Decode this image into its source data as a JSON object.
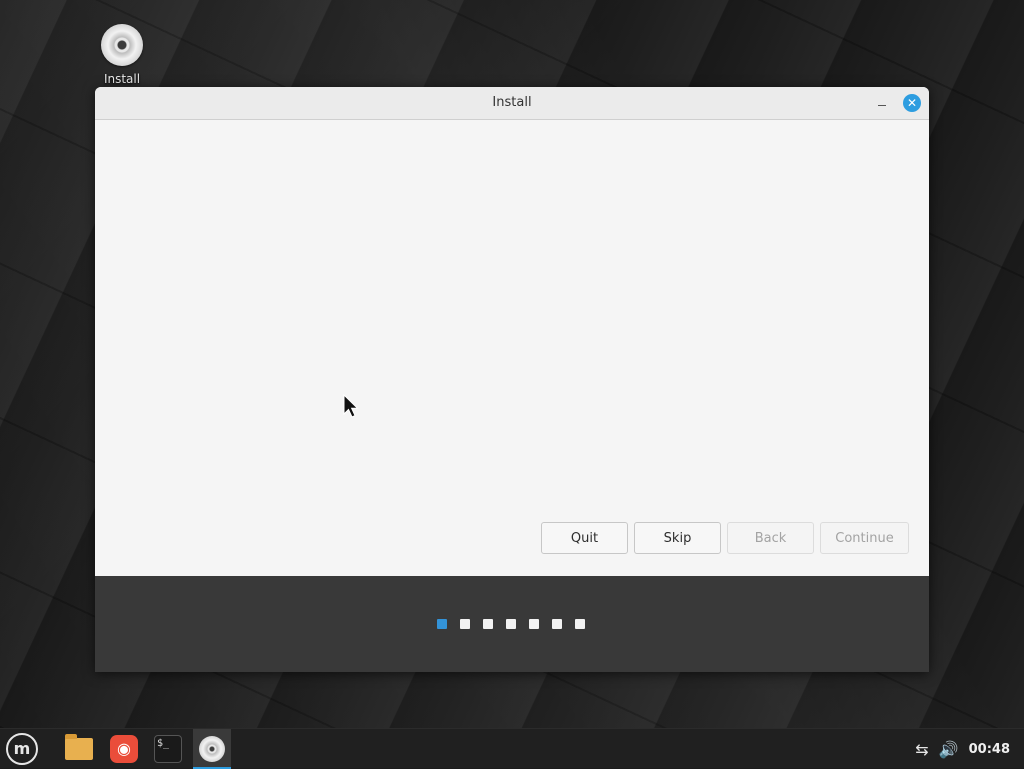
{
  "desktop": {
    "icons": [
      {
        "label": "Install",
        "icon": "disc-icon"
      }
    ]
  },
  "window": {
    "title": "Install",
    "minimize_glyph": "–",
    "close_glyph": "✕",
    "buttons": {
      "quit": "Quit",
      "skip": "Skip",
      "back": "Back",
      "continue": "Continue"
    },
    "slides": {
      "count": 7,
      "active_index": 0
    }
  },
  "taskbar": {
    "menu_glyph": "m",
    "items": [
      {
        "name": "files",
        "icon": "folder-icon"
      },
      {
        "name": "firefox",
        "icon": "firefox-icon"
      },
      {
        "name": "terminal",
        "icon": "terminal-icon",
        "glyph": "$_"
      },
      {
        "name": "install",
        "icon": "disc-icon",
        "active": true
      }
    ],
    "tray": {
      "network_glyph": "⇆",
      "volume_glyph": "🔊",
      "clock": "00:48"
    }
  },
  "colors": {
    "accent": "#2d9de0",
    "dot_active": "#3393d8",
    "slide_bar": "#393939"
  }
}
